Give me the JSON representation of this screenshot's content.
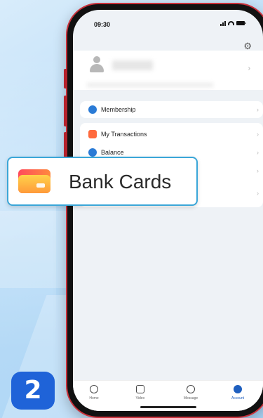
{
  "status": {
    "time": "09:30"
  },
  "menu": {
    "items": [
      {
        "label": "Membership",
        "icon": "membership-icon",
        "color": "#2a7bd6"
      },
      {
        "label": "My Transactions",
        "icon": "transactions-icon",
        "color": "#ff6a3d"
      },
      {
        "label": "Balance",
        "icon": "balance-icon",
        "color": "#2a7bd6"
      }
    ]
  },
  "callout": {
    "label": "Bank Cards",
    "icon": "bank-card-icon"
  },
  "tabs": [
    {
      "label": "Home",
      "icon": "home-icon"
    },
    {
      "label": "Video",
      "icon": "video-icon"
    },
    {
      "label": "Message",
      "icon": "message-icon"
    },
    {
      "label": "Account",
      "icon": "account-icon"
    }
  ],
  "step": {
    "number": "2"
  },
  "colors": {
    "accent": "#1f63d8",
    "callout_border": "#3aa6d8",
    "phone_frame": "#c9303a"
  }
}
